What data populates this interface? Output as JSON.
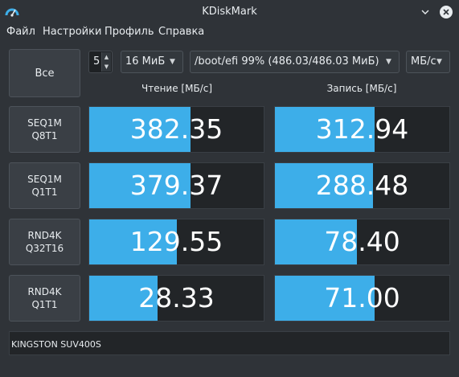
{
  "window": {
    "title": "KDiskMark"
  },
  "menu": [
    "Файл",
    "Настройки",
    "Профиль",
    "Справка"
  ],
  "toolbar": {
    "all_label": "Все",
    "runs_value": "5",
    "size_value": "16 МиБ",
    "target_value": "/boot/efi 99% (486.03/486.03 МиБ)",
    "unit_value": "МБ/с"
  },
  "headers": {
    "read": "Чтение [МБ/с]",
    "write": "Запись [МБ/с]"
  },
  "tests": [
    {
      "line1": "SEQ1M",
      "line2": "Q8T1",
      "read": "382.35",
      "read_fill": 0.58,
      "write": "312.94",
      "write_fill": 0.57
    },
    {
      "line1": "SEQ1M",
      "line2": "Q1T1",
      "read": "379.37",
      "read_fill": 0.58,
      "write": "288.48",
      "write_fill": 0.56
    },
    {
      "line1": "RND4K",
      "line2": "Q32T16",
      "read": "129.55",
      "read_fill": 0.5,
      "write": "78.40",
      "write_fill": 0.47
    },
    {
      "line1": "RND4K",
      "line2": "Q1T1",
      "read": "28.33",
      "read_fill": 0.39,
      "write": "71.00",
      "write_fill": 0.57
    }
  ],
  "device": {
    "name": "KINGSTON SUV400S"
  },
  "colors": {
    "accent": "#3daee9",
    "background": "#2f3338"
  }
}
